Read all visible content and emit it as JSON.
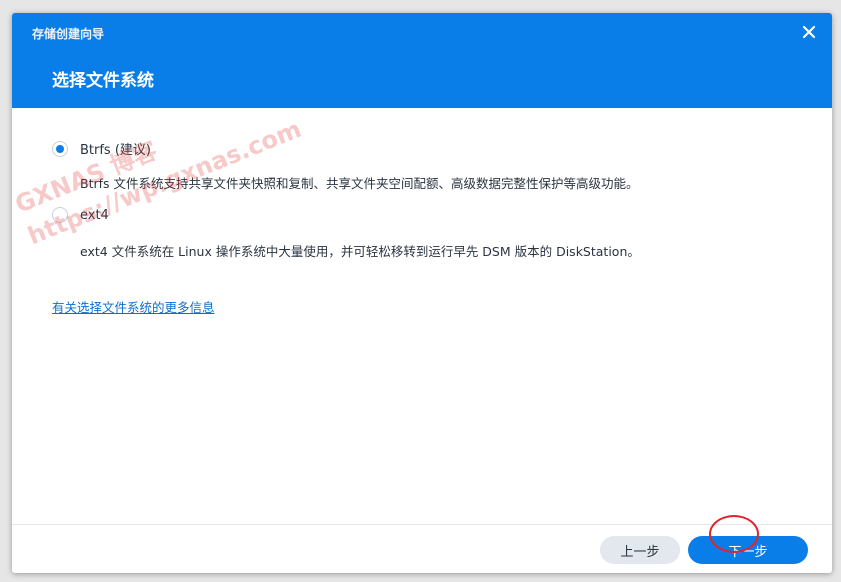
{
  "window": {
    "title": "存储创建向导"
  },
  "step": {
    "title": "选择文件系统"
  },
  "options": [
    {
      "label": "Btrfs (建议)",
      "description": "Btrfs 文件系统支持共享文件夹快照和复制、共享文件夹空间配额、高级数据完整性保护等高级功能。",
      "selected": true
    },
    {
      "label": "ext4",
      "description": "ext4 文件系统在 Linux 操作系统中大量使用，并可轻松移转到运行早先 DSM 版本的 DiskStation。",
      "selected": false
    }
  ],
  "more_info_link": "有关选择文件系统的更多信息",
  "footer": {
    "prev_label": "上一步",
    "next_label": "下一步"
  },
  "watermark": {
    "line1": "GXNAS 博客",
    "line2": "https://wp.gxnas.com"
  },
  "colors": {
    "accent": "#0a7ee8",
    "annotation": "#e0242a"
  }
}
